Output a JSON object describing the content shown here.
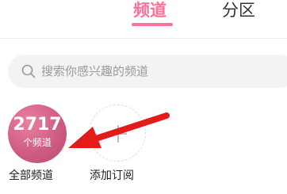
{
  "tabs": [
    {
      "label": "频道",
      "active": true
    },
    {
      "label": "分区",
      "active": false
    }
  ],
  "search": {
    "icon": "search-icon",
    "placeholder": "搜索你感兴趣的频道"
  },
  "channels": {
    "all": {
      "count": "2717",
      "unit": "个频道",
      "label": "全部频道"
    },
    "add": {
      "icon": "plus-icon",
      "label": "添加订阅"
    }
  },
  "colors": {
    "accent": "#fb7299",
    "arrow": "#e31b1b"
  }
}
